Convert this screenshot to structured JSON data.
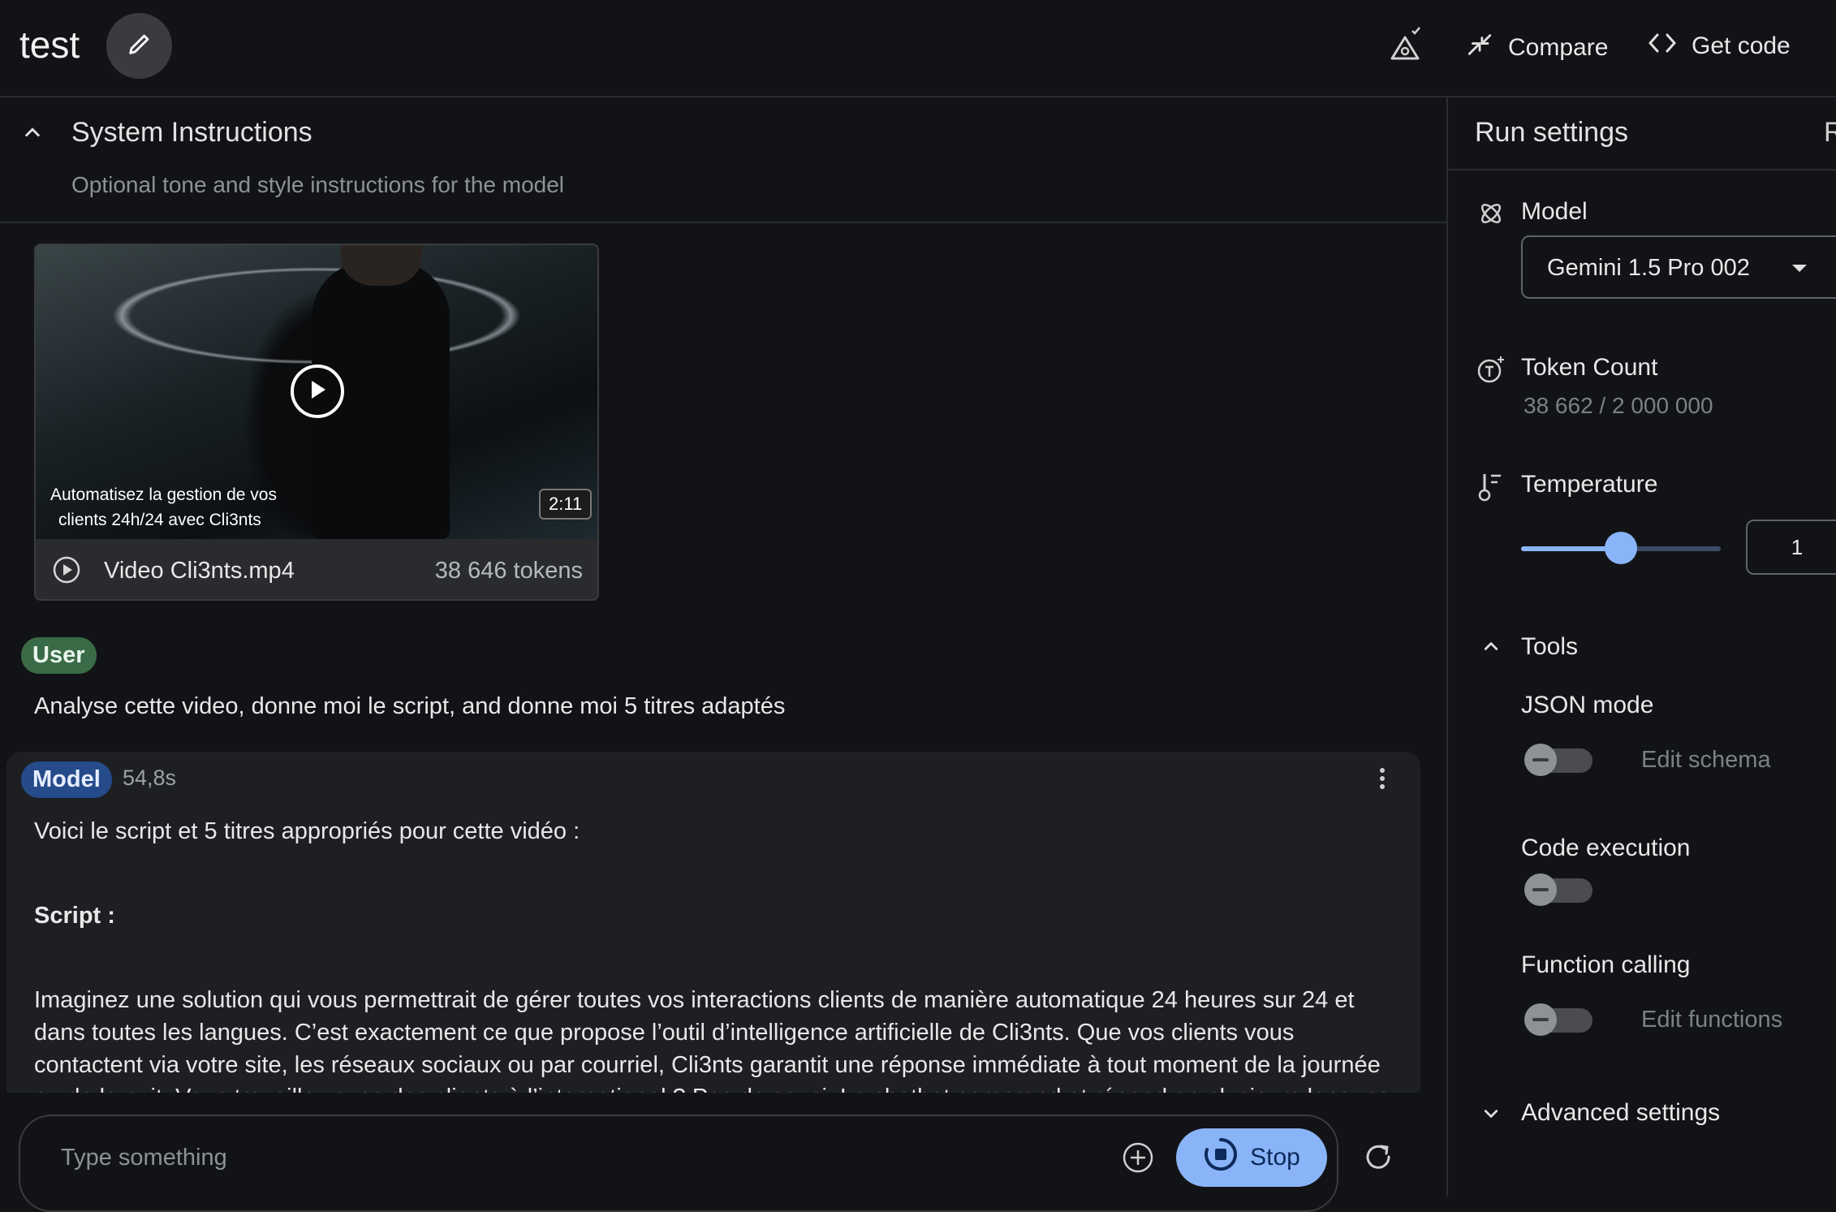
{
  "header": {
    "title": "test",
    "compare_label": "Compare",
    "get_code_label": "Get code"
  },
  "system_instructions": {
    "title": "System Instructions",
    "placeholder": "Optional tone and style instructions for the model"
  },
  "video": {
    "caption_line1": "Automatisez la gestion de vos",
    "caption_line2": "clients 24h/24  avec Cli3nts",
    "duration": "2:11",
    "filename": "Video Cli3nts.mp4",
    "tokens": "38 646 tokens"
  },
  "user_turn": {
    "role": "User",
    "text": "Analyse cette video, donne moi le script, and donne moi 5 titres adaptés"
  },
  "model_turn": {
    "role": "Model",
    "time": "54,8s",
    "line1": "Voici le script et 5 titres appropriés pour cette vidéo :",
    "line2": "Script :",
    "paragraph": "Imaginez une solution qui vous permettrait de gérer toutes vos interactions clients de manière automatique 24 heures sur 24 et dans toutes les langues. C’est exactement ce que propose l’outil d’intelligence artificielle de Cli3nts. Que vos clients vous contactent via votre site, les réseaux sociaux ou par courriel, Cli3nts garantit une réponse immédiate à tout moment de la journée ou de la nuit. Vous travaillez avec des clients à l’international ? Pas de souci. Le chatbot comprend et répond en plusieurs langues"
  },
  "input": {
    "placeholder": "Type something",
    "stop_label": "Stop"
  },
  "run_settings": {
    "title": "Run settings",
    "truncated_label": "R",
    "model_label": "Model",
    "model_value": "Gemini 1.5 Pro 002",
    "token_count_label": "Token Count",
    "token_count_value": "38 662 / 2 000 000",
    "temperature_label": "Temperature",
    "temperature_value": "1",
    "temperature_fraction": 0.5,
    "tools_label": "Tools",
    "json_mode_label": "JSON mode",
    "edit_schema_label": "Edit schema",
    "code_execution_label": "Code execution",
    "function_calling_label": "Function calling",
    "edit_functions_label": "Edit functions",
    "advanced_settings_label": "Advanced settings"
  },
  "colors": {
    "background": "#121316",
    "accent": "#8ab4f8",
    "user_chip": "#3a6b47",
    "model_chip": "#264b8a"
  }
}
